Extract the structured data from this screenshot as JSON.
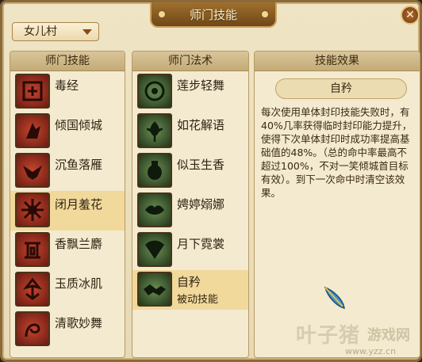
{
  "window": {
    "title": "师门技能",
    "close_glyph": "✕"
  },
  "school_dropdown": {
    "selected": "女儿村"
  },
  "skills_panel": {
    "header": "师门技能",
    "items": [
      {
        "label": "毒经",
        "icon": "poison-scroll-icon"
      },
      {
        "label": "倾国倾城",
        "icon": "dancer-icon"
      },
      {
        "label": "沉鱼落雁",
        "icon": "goose-icon"
      },
      {
        "label": "闭月羞花",
        "icon": "moon-flower-icon",
        "selected": true
      },
      {
        "label": "香飘兰麝",
        "icon": "incense-icon"
      },
      {
        "label": "玉质冰肌",
        "icon": "jade-icon"
      },
      {
        "label": "清歌妙舞",
        "icon": "song-dance-icon"
      }
    ]
  },
  "spells_panel": {
    "header": "师门法术",
    "items": [
      {
        "label": "莲步轻舞",
        "icon": "lotus-step-icon"
      },
      {
        "label": "如花解语",
        "icon": "flower-icon"
      },
      {
        "label": "似玉生香",
        "icon": "vase-icon"
      },
      {
        "label": "娉婷嫋娜",
        "icon": "lips-icon"
      },
      {
        "label": "月下霓裳",
        "icon": "fan-icon"
      },
      {
        "label": "自矜",
        "sub": "被动技能",
        "icon": "handshake-icon",
        "selected": true
      }
    ]
  },
  "effect_panel": {
    "header": "技能效果",
    "skill_name": "自矜",
    "description": "每次使用单体封印技能失败时，有40%几率获得临时封印能力提升，使得下次单体封印时成功率提高基础值的48%。（总的命中率最高不超过100%，不对一笑倾城首目标有效）。到下一次命中时清空该效果。"
  },
  "watermark": {
    "brand": "叶子猪",
    "sub": "游戏网",
    "url": "www.yzz.cn"
  },
  "colors": {
    "accent": "#a0702e",
    "selected_row": "#f1d89b",
    "red_icon": "#9a2d1c",
    "green_icon": "#3d5a30"
  }
}
